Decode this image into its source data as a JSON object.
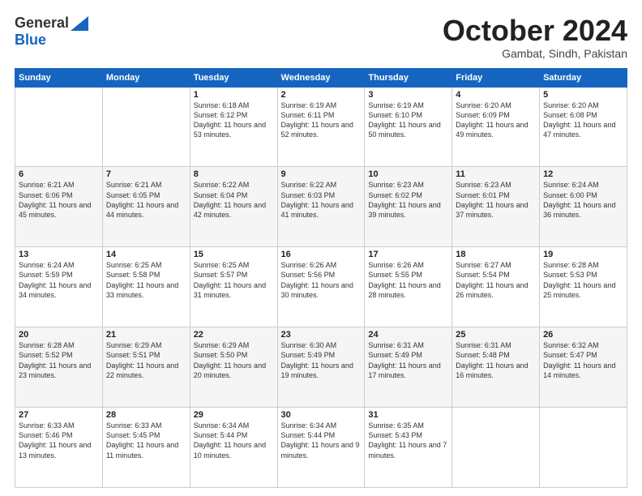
{
  "header": {
    "logo_general": "General",
    "logo_blue": "Blue",
    "month_title": "October 2024",
    "location": "Gambat, Sindh, Pakistan"
  },
  "days_of_week": [
    "Sunday",
    "Monday",
    "Tuesday",
    "Wednesday",
    "Thursday",
    "Friday",
    "Saturday"
  ],
  "weeks": [
    [
      {
        "day": "",
        "info": ""
      },
      {
        "day": "",
        "info": ""
      },
      {
        "day": "1",
        "info": "Sunrise: 6:18 AM\nSunset: 6:12 PM\nDaylight: 11 hours and 53 minutes."
      },
      {
        "day": "2",
        "info": "Sunrise: 6:19 AM\nSunset: 6:11 PM\nDaylight: 11 hours and 52 minutes."
      },
      {
        "day": "3",
        "info": "Sunrise: 6:19 AM\nSunset: 6:10 PM\nDaylight: 11 hours and 50 minutes."
      },
      {
        "day": "4",
        "info": "Sunrise: 6:20 AM\nSunset: 6:09 PM\nDaylight: 11 hours and 49 minutes."
      },
      {
        "day": "5",
        "info": "Sunrise: 6:20 AM\nSunset: 6:08 PM\nDaylight: 11 hours and 47 minutes."
      }
    ],
    [
      {
        "day": "6",
        "info": "Sunrise: 6:21 AM\nSunset: 6:06 PM\nDaylight: 11 hours and 45 minutes."
      },
      {
        "day": "7",
        "info": "Sunrise: 6:21 AM\nSunset: 6:05 PM\nDaylight: 11 hours and 44 minutes."
      },
      {
        "day": "8",
        "info": "Sunrise: 6:22 AM\nSunset: 6:04 PM\nDaylight: 11 hours and 42 minutes."
      },
      {
        "day": "9",
        "info": "Sunrise: 6:22 AM\nSunset: 6:03 PM\nDaylight: 11 hours and 41 minutes."
      },
      {
        "day": "10",
        "info": "Sunrise: 6:23 AM\nSunset: 6:02 PM\nDaylight: 11 hours and 39 minutes."
      },
      {
        "day": "11",
        "info": "Sunrise: 6:23 AM\nSunset: 6:01 PM\nDaylight: 11 hours and 37 minutes."
      },
      {
        "day": "12",
        "info": "Sunrise: 6:24 AM\nSunset: 6:00 PM\nDaylight: 11 hours and 36 minutes."
      }
    ],
    [
      {
        "day": "13",
        "info": "Sunrise: 6:24 AM\nSunset: 5:59 PM\nDaylight: 11 hours and 34 minutes."
      },
      {
        "day": "14",
        "info": "Sunrise: 6:25 AM\nSunset: 5:58 PM\nDaylight: 11 hours and 33 minutes."
      },
      {
        "day": "15",
        "info": "Sunrise: 6:25 AM\nSunset: 5:57 PM\nDaylight: 11 hours and 31 minutes."
      },
      {
        "day": "16",
        "info": "Sunrise: 6:26 AM\nSunset: 5:56 PM\nDaylight: 11 hours and 30 minutes."
      },
      {
        "day": "17",
        "info": "Sunrise: 6:26 AM\nSunset: 5:55 PM\nDaylight: 11 hours and 28 minutes."
      },
      {
        "day": "18",
        "info": "Sunrise: 6:27 AM\nSunset: 5:54 PM\nDaylight: 11 hours and 26 minutes."
      },
      {
        "day": "19",
        "info": "Sunrise: 6:28 AM\nSunset: 5:53 PM\nDaylight: 11 hours and 25 minutes."
      }
    ],
    [
      {
        "day": "20",
        "info": "Sunrise: 6:28 AM\nSunset: 5:52 PM\nDaylight: 11 hours and 23 minutes."
      },
      {
        "day": "21",
        "info": "Sunrise: 6:29 AM\nSunset: 5:51 PM\nDaylight: 11 hours and 22 minutes."
      },
      {
        "day": "22",
        "info": "Sunrise: 6:29 AM\nSunset: 5:50 PM\nDaylight: 11 hours and 20 minutes."
      },
      {
        "day": "23",
        "info": "Sunrise: 6:30 AM\nSunset: 5:49 PM\nDaylight: 11 hours and 19 minutes."
      },
      {
        "day": "24",
        "info": "Sunrise: 6:31 AM\nSunset: 5:49 PM\nDaylight: 11 hours and 17 minutes."
      },
      {
        "day": "25",
        "info": "Sunrise: 6:31 AM\nSunset: 5:48 PM\nDaylight: 11 hours and 16 minutes."
      },
      {
        "day": "26",
        "info": "Sunrise: 6:32 AM\nSunset: 5:47 PM\nDaylight: 11 hours and 14 minutes."
      }
    ],
    [
      {
        "day": "27",
        "info": "Sunrise: 6:33 AM\nSunset: 5:46 PM\nDaylight: 11 hours and 13 minutes."
      },
      {
        "day": "28",
        "info": "Sunrise: 6:33 AM\nSunset: 5:45 PM\nDaylight: 11 hours and 11 minutes."
      },
      {
        "day": "29",
        "info": "Sunrise: 6:34 AM\nSunset: 5:44 PM\nDaylight: 11 hours and 10 minutes."
      },
      {
        "day": "30",
        "info": "Sunrise: 6:34 AM\nSunset: 5:44 PM\nDaylight: 11 hours and 9 minutes."
      },
      {
        "day": "31",
        "info": "Sunrise: 6:35 AM\nSunset: 5:43 PM\nDaylight: 11 hours and 7 minutes."
      },
      {
        "day": "",
        "info": ""
      },
      {
        "day": "",
        "info": ""
      }
    ]
  ]
}
